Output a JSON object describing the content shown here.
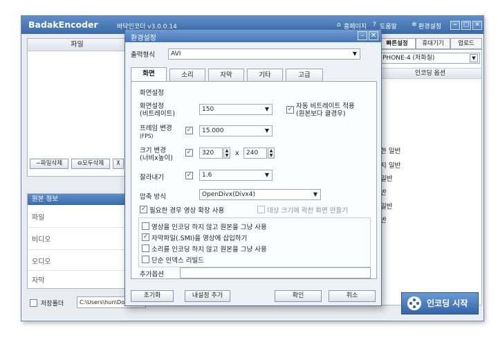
{
  "main": {
    "app_title": "BadakEncoder",
    "app_subtitle": "바닥인코더 v3.0.0.14",
    "top_links": {
      "homepage": "홈페이지",
      "help": "도움말",
      "settings": "환경설정"
    },
    "file_panel": {
      "header": "파일",
      "delete_file": "파일삭제",
      "delete_all": "모두삭제"
    },
    "source_info": {
      "header": "원본 정보",
      "rows": [
        "파일",
        "비디오",
        "오디오",
        "자막"
      ]
    },
    "save_folder": {
      "label": "저장폴더",
      "path": "C:\\Users\\hun\\Docu"
    },
    "right_tabs": [
      "빠른설정",
      "휴대기기",
      "업로드"
    ],
    "device": "PHONE-4 (저화질)",
    "encoding_option_header": "인코딩 옵션",
    "option_items": [
      "한 일반",
      "지 일반",
      "일반",
      "반",
      "일반",
      "반"
    ],
    "encode_start": "인코딩 시작"
  },
  "dialog": {
    "title": "환경설정",
    "output_format_label": "출력형식",
    "output_format_value": "AVI",
    "tabs": [
      "화면",
      "소리",
      "자막",
      "기타",
      "고급"
    ],
    "active_tab": 0,
    "section_title": "화면설정",
    "video_settings": {
      "label_line1": "화면설정",
      "label_line2": "(비트레이트)",
      "value": "150",
      "auto_bitrate_line1": "자동 비트레이트 적용",
      "auto_bitrate_line2": "(원본보다 클경우)",
      "auto_bitrate_checked": true
    },
    "frame_change": {
      "label_line1": "프레임 변경",
      "label_line2": "(FPS)",
      "checked": true,
      "value": "15.000"
    },
    "size_change": {
      "label_line1": "크기 변경",
      "label_line2": "(너비x높이)",
      "checked": true,
      "width": "320",
      "x": "x",
      "height": "240"
    },
    "crop": {
      "label": "잘라내기",
      "checked": true,
      "value": "1.6"
    },
    "compression": {
      "label": "압축 방식",
      "value": "OpenDivx(Divx4)"
    },
    "expand_if_needed": {
      "label": "필요한 경우 영상 확장 사용",
      "checked": true
    },
    "fit_screen": {
      "label": "대상 크기에 꽉찬 화면 만들기",
      "checked": false,
      "disabled": true
    },
    "options": [
      {
        "label": "영상을 인코딩 하지 않고 원본을 그냥 사용",
        "checked": false
      },
      {
        "label": "자막파일(.SMI)을 영상에 삽입하기",
        "checked": true
      },
      {
        "label": "소리를 인코딩 하지 않고 원본을 그냥 사용",
        "checked": false
      },
      {
        "label": "단순 인덱스 리빌드",
        "checked": false
      }
    ],
    "extra_options_label": "추가옵션",
    "extra_options_value": "",
    "buttons": {
      "reset": "초기화",
      "add_my_setting": "내설정 추가",
      "ok": "확인",
      "cancel": "취소"
    }
  }
}
